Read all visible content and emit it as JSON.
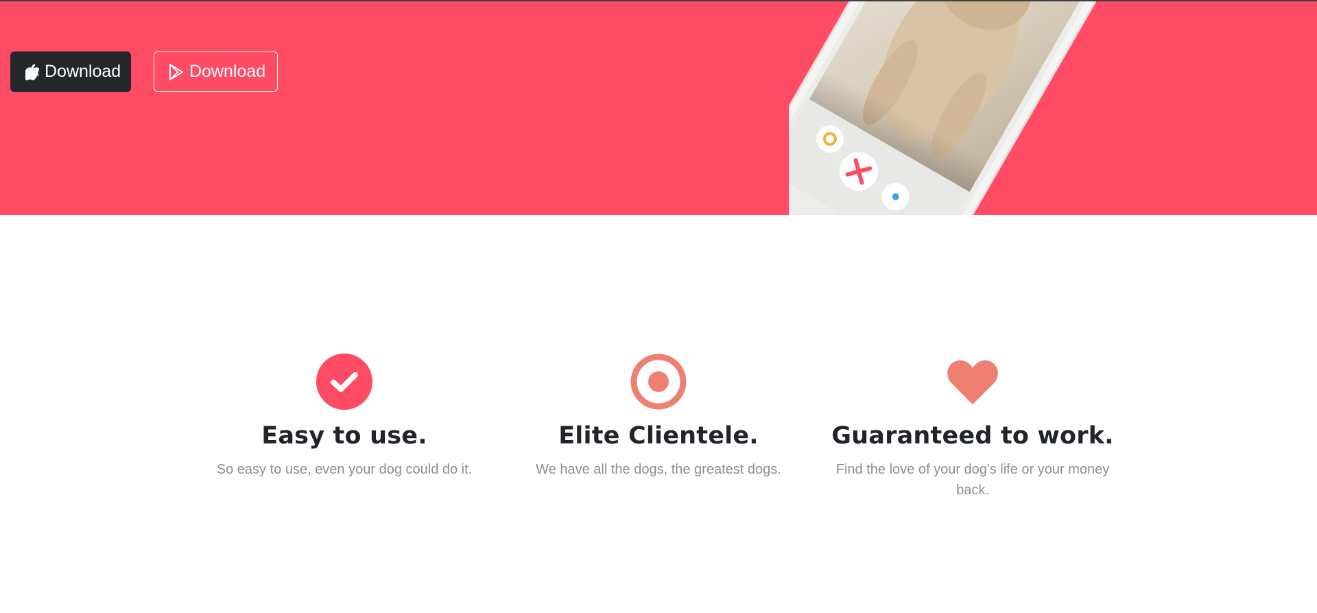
{
  "hero": {
    "background_color": "#ff4b64",
    "apple_button": {
      "label": "Download",
      "icon": "apple-icon"
    },
    "play_button": {
      "label": "Download",
      "icon": "google-play-icon"
    }
  },
  "phone": {
    "image": "dog-photo",
    "action_icons": [
      "rewind-icon",
      "close-icon",
      "star-icon"
    ]
  },
  "features": [
    {
      "icon": "check-circle-icon",
      "title": "Easy to use.",
      "text": "So easy to use, even your dog could do it."
    },
    {
      "icon": "bullseye-icon",
      "title": "Elite Clientele.",
      "text": "We have all the dogs, the greatest dogs."
    },
    {
      "icon": "heart-icon",
      "title": "Guaranteed to work.",
      "text": "Find the love of your dog's life or your money back."
    }
  ],
  "colors": {
    "accent": "#ff4b64",
    "salmon": "#ef7f71",
    "dark": "#23272c"
  }
}
